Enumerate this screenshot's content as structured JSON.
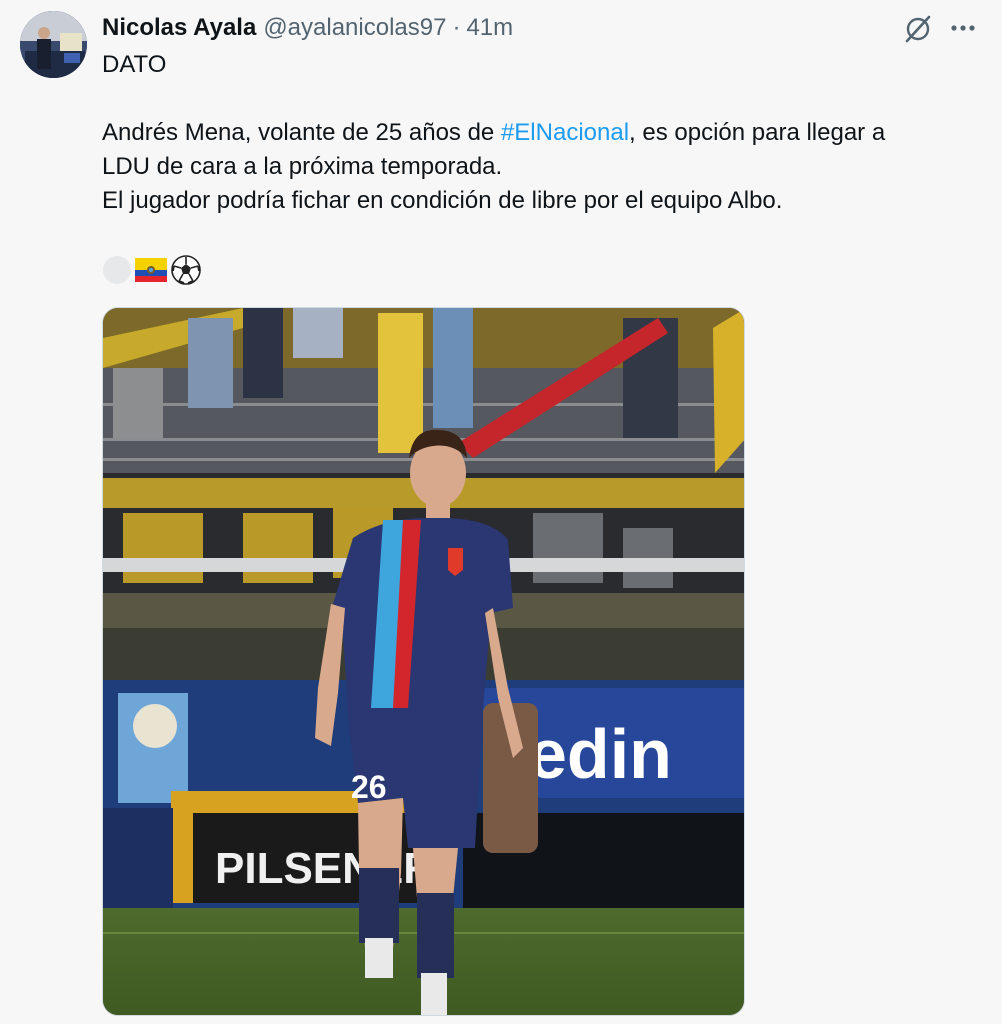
{
  "tweet": {
    "author_name": "Nicolas Ayala",
    "handle": "@ayalanicolas97",
    "separator": "·",
    "time": "41m",
    "lines": {
      "heading": "DATO",
      "line1_before": "Andrés Mena, volante de 25 años de ",
      "hashtag": "#ElNacional",
      "line1_after": ", es opción para llegar a",
      "line2": "LDU de cara a la próxima temporada.",
      "line3": "El jugador podría fichar en condición de libre por el equipo Albo."
    },
    "emoji_icons": [
      "white-circle-icon",
      "ecuador-flag-icon",
      "soccer-ball-icon"
    ],
    "photo": {
      "jersey_number": "26",
      "banner_text": "PILSENER",
      "ad_text": "edin"
    }
  },
  "colors": {
    "link": "#1d9bf0",
    "text": "#0f1419",
    "muted": "#536471",
    "background": "#f7f7f7"
  },
  "icons": {
    "action_1": "grok-icon",
    "action_2": "more-options-icon"
  }
}
